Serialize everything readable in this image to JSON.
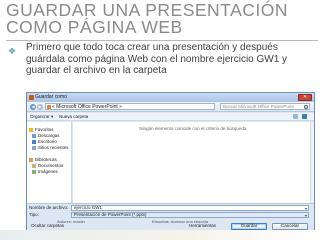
{
  "slide": {
    "title": "GUARDAR UNA PRESENTACIÓN COMO PÁGINA WEB",
    "bullet_glyph": "❖",
    "body": "Primero que todo toca crear una presentación y después guárdala como página Web con el nombre ejercicio GW1 y guardar el archivo en la carpeta"
  },
  "dialog": {
    "title": "Guardar como",
    "close_glyph": "✕",
    "address_path": "« Microsoft Office PowerPoint »",
    "search_placeholder": "Buscar Microsoft Office PowerPoint",
    "commands": {
      "organize": "Organizar ▾",
      "new_folder": "Nueva carpeta"
    },
    "sidebar": [
      {
        "label": "Favoritos",
        "icon": "star-icon"
      },
      {
        "label": "Descargas",
        "icon": "download-folder-icon"
      },
      {
        "label": "Escritorio",
        "icon": "desktop-icon"
      },
      {
        "label": "Sitios recientes",
        "icon": "recent-places-icon"
      },
      {
        "label": "Bibliotecas",
        "icon": "library-icon"
      },
      {
        "label": "Documentos",
        "icon": "documents-icon"
      },
      {
        "label": "Imágenes",
        "icon": "pictures-icon"
      }
    ],
    "empty_message": "Ningún elemento coincide con el criterio de búsqueda.",
    "filename_label": "Nombre de archivo:",
    "filename_value": "ejercicio GW1",
    "type_label": "Tipo:",
    "type_value": "Presentación de PowerPoint (*.pptx)",
    "authors_label": "Autores: master",
    "tags_label": "Etiquetas: Agregar una etiqueta",
    "hide_folders": "Ocultar carpetas",
    "tools": "Herramientas",
    "save": "Guardar",
    "cancel": "Cancelar"
  },
  "colors": {
    "title": "#8a8a8a",
    "bullet": "#6aa0a8",
    "dialog_bg": "#dce7f3"
  }
}
